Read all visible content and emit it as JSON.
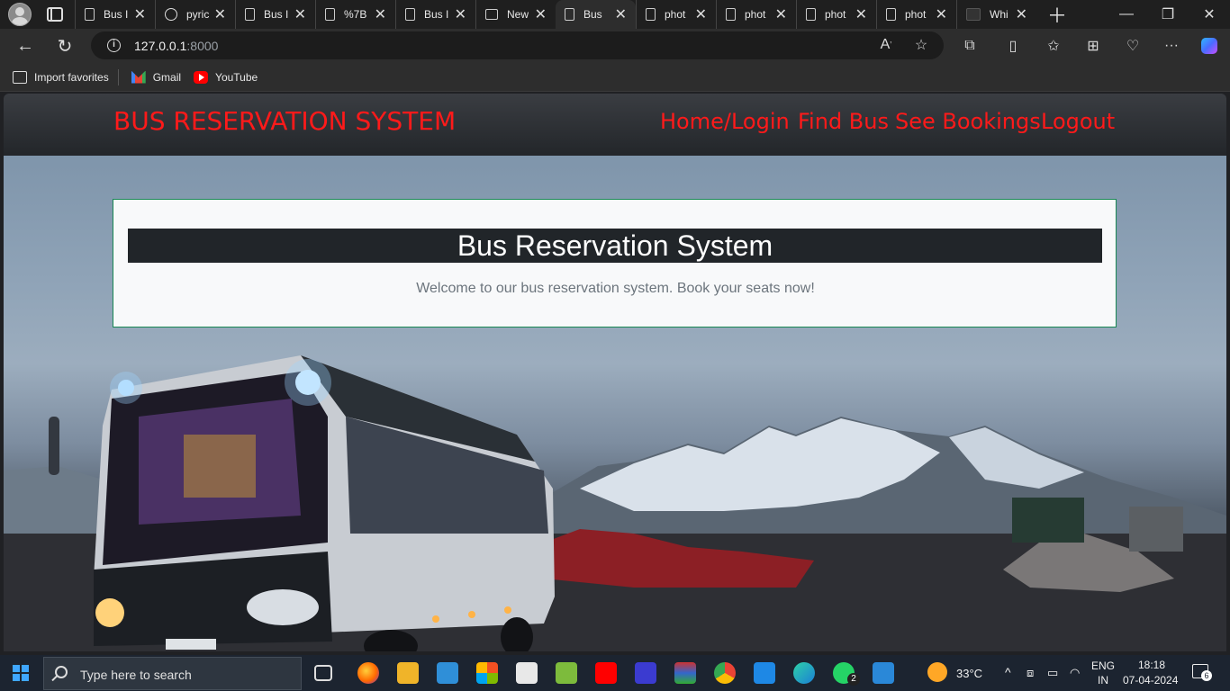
{
  "browser": {
    "tabs": [
      {
        "title": "Bus I",
        "icon": "page-icon"
      },
      {
        "title": "pyric",
        "icon": "github-icon"
      },
      {
        "title": "Bus I",
        "icon": "page-icon"
      },
      {
        "title": "%7B",
        "icon": "page-icon"
      },
      {
        "title": "Bus I",
        "icon": "page-icon"
      },
      {
        "title": "New",
        "icon": "newtab-icon"
      },
      {
        "title": "Bus",
        "icon": "page-icon",
        "active": true
      },
      {
        "title": "phot",
        "icon": "page-icon"
      },
      {
        "title": "phot",
        "icon": "page-icon"
      },
      {
        "title": "phot",
        "icon": "page-icon"
      },
      {
        "title": "phot",
        "icon": "page-icon"
      },
      {
        "title": "Whi",
        "icon": "whatsapp-web-icon"
      }
    ],
    "address": {
      "host": "127.0.0.1",
      "port": ":8000"
    },
    "favorites": [
      {
        "label": "Import favorites",
        "icon": "import-icon"
      },
      {
        "label": "Gmail",
        "icon": "gmail-icon"
      },
      {
        "label": "YouTube",
        "icon": "youtube-icon"
      }
    ]
  },
  "site": {
    "brand": "BUS RESERVATION SYSTEM",
    "nav": [
      "Home/Login",
      "Find Bus",
      "See Bookings",
      "Logout"
    ],
    "brand_color": "#ff1a1a",
    "card": {
      "title": "Bus Reservation System",
      "subtitle": "Welcome to our bus reservation system. Book your seats now!"
    }
  },
  "taskbar": {
    "search_placeholder": "Type here to search",
    "weather": "33°C",
    "lang": "ENG",
    "region": "IN",
    "time": "18:18",
    "date": "07-04-2024",
    "whatsapp_badge": "2",
    "notifications": "6"
  }
}
